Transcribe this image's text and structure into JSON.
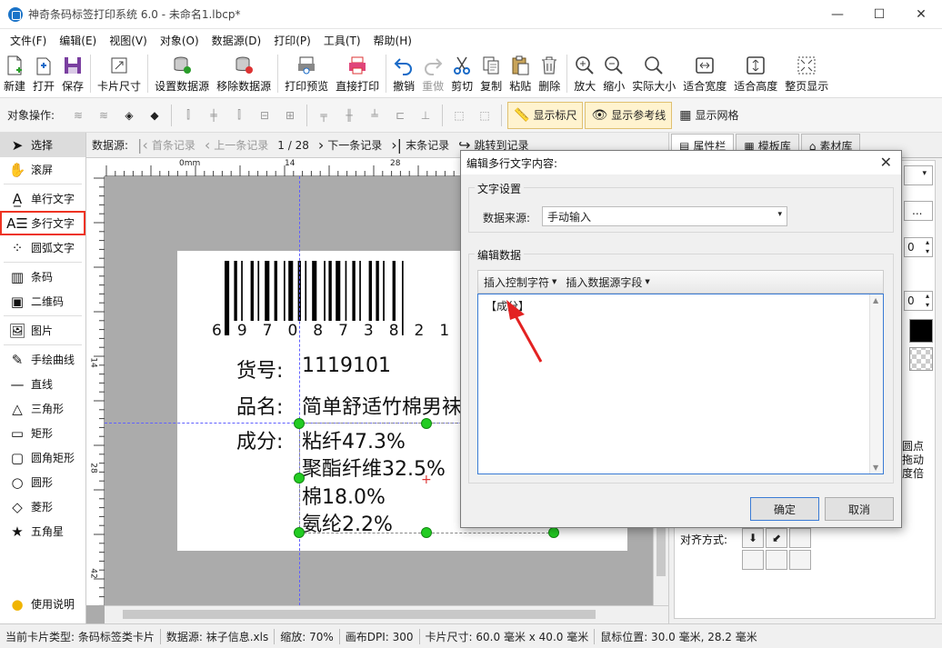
{
  "window": {
    "title": "神奇条码标签打印系统 6.0 - 未命名1.lbcp*",
    "minimize": "—",
    "maximize": "☐",
    "close": "✕"
  },
  "menu": [
    "文件(F)",
    "编辑(E)",
    "视图(V)",
    "对象(O)",
    "数据源(D)",
    "打印(P)",
    "工具(T)",
    "帮助(H)"
  ],
  "toolbar": {
    "new": "新建",
    "open": "打开",
    "save": "保存",
    "card_size": "卡片尺寸",
    "set_datasource": "设置数据源",
    "remove_datasource": "移除数据源",
    "print_preview": "打印预览",
    "direct_print": "直接打印",
    "undo": "撤销",
    "redo": "重做",
    "cut": "剪切",
    "copy": "复制",
    "paste": "粘贴",
    "delete": "删除",
    "zoom_in": "放大",
    "zoom_out": "缩小",
    "actual_size": "实际大小",
    "fit_width": "适合宽度",
    "fit_height": "适合高度",
    "fit_page": "整页显示"
  },
  "objbar": {
    "label": "对象操作:",
    "show_ruler": "显示标尺",
    "show_guides": "显示参考线",
    "show_grid": "显示网格"
  },
  "tools": {
    "select": "选择",
    "scroll": "滚屏",
    "single_text": "单行文字",
    "multi_text": "多行文字",
    "arc_text": "圆弧文字",
    "barcode": "条码",
    "qrcode": "二维码",
    "image": "图片",
    "freehand": "手绘曲线",
    "line": "直线",
    "triangle": "三角形",
    "rectangle": "矩形",
    "rounded_rect": "圆角矩形",
    "circle": "圆形",
    "diamond": "菱形",
    "star": "五角星",
    "help": "使用说明"
  },
  "navbar": {
    "label": "数据源:",
    "first": "首条记录",
    "prev": "上一条记录",
    "position": "1 / 28",
    "next": "下一条记录",
    "last": "末条记录",
    "goto": "跳转到记录"
  },
  "ruler": {
    "unit": "0mm",
    "top_marks": [
      "14",
      "28"
    ],
    "left_marks": [
      "14",
      "28",
      "42"
    ]
  },
  "label": {
    "barcode_digits": "6970873821",
    "item_no_label": "货号:",
    "item_no_value": "1119101",
    "name_label": "品名:",
    "name_value": "简单舒适竹棉男袜",
    "composition_label": "成分:",
    "composition_lines": [
      "粘纤47.3%",
      "聚酯纤维32.5%",
      "棉18.0%",
      "氨纶2.2%"
    ]
  },
  "rightpanel": {
    "tabs": [
      "属性栏",
      "模板库",
      "素材库"
    ],
    "spin_value_1": "0",
    "spin_value_2": "0",
    "more_btn": "...",
    "snippet_1": "圆点",
    "snippet_2": "拖动",
    "snippet_3": "度倍",
    "align_label": "对齐方式:"
  },
  "dialog": {
    "title": "编辑多行文字内容:",
    "text_settings": "文字设置",
    "datasource_label": "数据来源:",
    "datasource_value": "手动输入",
    "edit_data": "编辑数据",
    "insert_control": "插入控制字符",
    "insert_field": "插入数据源字段",
    "content": "【成分】",
    "ok": "确定",
    "cancel": "取消"
  },
  "status": {
    "card_type": "当前卡片类型: 条码标签类卡片",
    "datasource": "数据源: 袜子信息.xls",
    "zoom": "缩放: 70%",
    "dpi": "画布DPI: 300",
    "card_size": "卡片尺寸: 60.0 毫米 x 40.0 毫米",
    "mouse_pos": "鼠标位置: 30.0 毫米, 28.2 毫米"
  },
  "colors": {
    "accent": "#3a7bd5",
    "handle": "#22cc22",
    "highlight": "#e32222",
    "guide": "#6060ff"
  }
}
